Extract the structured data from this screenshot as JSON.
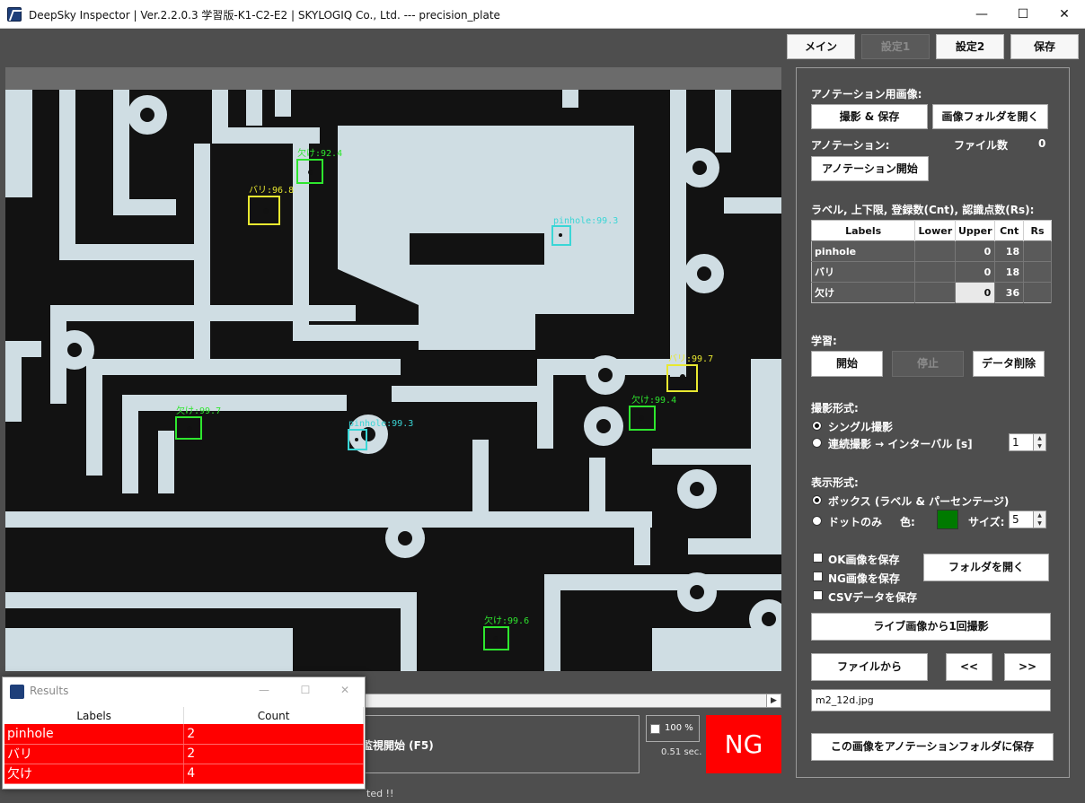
{
  "window": {
    "title": "DeepSky Inspector | Ver.2.2.0.3 学習版-K1-C2-E2 | SKYLOGIQ Co., Ltd. --- precision_plate",
    "minimize": "—",
    "maximize": "☐",
    "close": "✕"
  },
  "nav": {
    "main": "メイン",
    "settings1": "設定1",
    "settings2": "設定2",
    "save": "保存"
  },
  "detections": [
    {
      "label": "欠け:92.4",
      "color": "#2ee62e"
    },
    {
      "label": "バリ:96.8",
      "color": "#e8e830"
    },
    {
      "label": "pinhole:99.3",
      "color": "#3ad6d6"
    },
    {
      "label": "バリ:99.7",
      "color": "#e8e830"
    },
    {
      "label": "欠け:99.7",
      "color": "#2ee62e"
    },
    {
      "label": "pinhole:99.3",
      "color": "#3ad6d6"
    },
    {
      "label": "欠け:99.4",
      "color": "#2ee62e"
    },
    {
      "label": "欠け:99.6",
      "color": "#2ee62e"
    }
  ],
  "bottom": {
    "monitor_text": "監視開始 (F5)",
    "zoom": "100 %",
    "elapsed": "0.51 sec.",
    "verdict": "NG",
    "status": "ted !!"
  },
  "results": {
    "title": "Results",
    "columns": [
      "Labels",
      "Count"
    ],
    "rows": [
      {
        "label": "pinhole",
        "count": "2"
      },
      {
        "label": "バリ",
        "count": "2"
      },
      {
        "label": "欠け",
        "count": "4"
      }
    ]
  },
  "panel": {
    "annot_image_heading": "アノテーション用画像:",
    "capture_save": "撮影 & 保存",
    "open_image_folder": "画像フォルダを開く",
    "annotation_heading": "アノテーション:",
    "file_count_label": "ファイル数",
    "file_count": "0",
    "start_annotation": "アノテーション開始",
    "label_table_heading": "ラベル, 上下限, 登録数(Cnt), 認識点数(Rs):",
    "label_columns": [
      "Labels",
      "Lower",
      "Upper",
      "Cnt",
      "Rs"
    ],
    "label_rows": [
      {
        "label": "pinhole",
        "lower": "",
        "upper": "0",
        "cnt": "18",
        "rs": ""
      },
      {
        "label": "バリ",
        "lower": "",
        "upper": "0",
        "cnt": "18",
        "rs": ""
      },
      {
        "label": "欠け",
        "lower": "",
        "upper": "0",
        "cnt": "36",
        "rs": ""
      }
    ],
    "learning_heading": "学習:",
    "start": "開始",
    "stop": "停止",
    "delete_data": "データ削除",
    "capture_mode_heading": "撮影形式:",
    "single_capture": "シングル撮影",
    "continuous_capture": "連続撮影 → インターバル [s]",
    "interval": "1",
    "display_mode_heading": "表示形式:",
    "box_mode": "ボックス (ラベル & パーセンテージ)",
    "dot_mode": "ドットのみ",
    "color_label": "色:",
    "swatch_color": "#007a00",
    "size_label": "サイズ:",
    "size": "5",
    "save_ok": "OK画像を保存",
    "save_ng": "NG画像を保存",
    "save_csv": "CSVデータを保存",
    "open_folder": "フォルダを開く",
    "capture_once": "ライブ画像から1回撮影",
    "from_file": "ファイルから",
    "prev": "<<",
    "next": ">>",
    "filename": "m2_12d.jpg",
    "save_to_annotation": "この画像をアノテーションフォルダに保存"
  }
}
